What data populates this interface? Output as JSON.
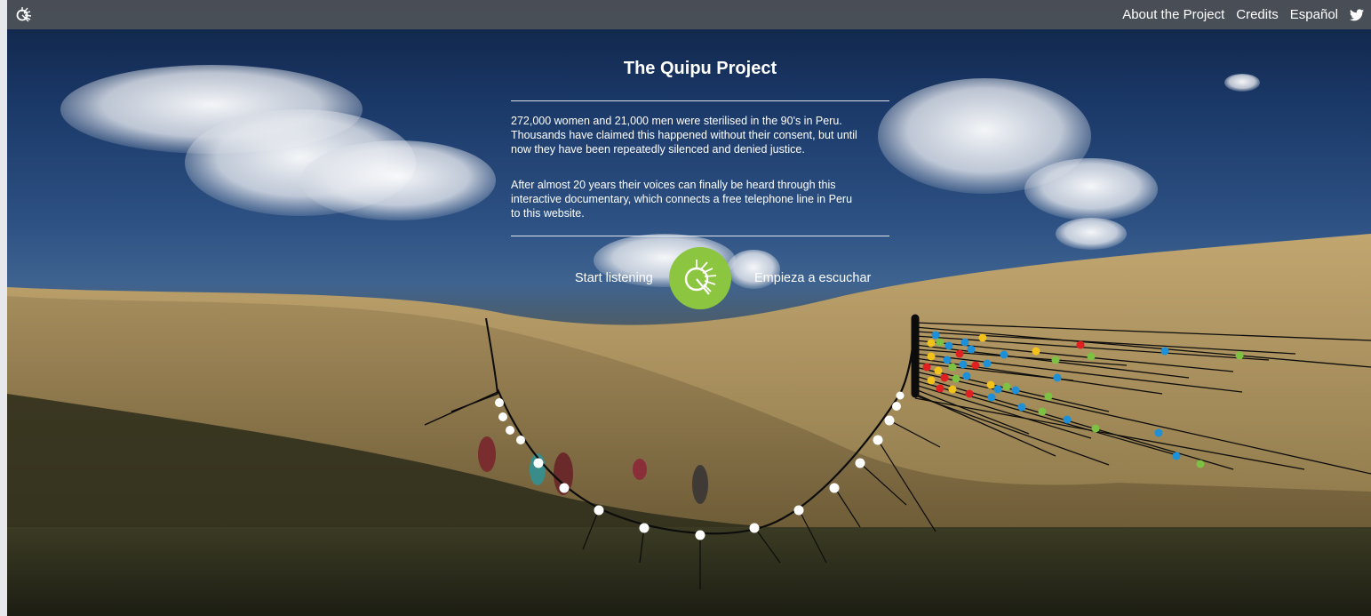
{
  "header": {
    "logo_icon": "quipu-logo-icon",
    "nav": [
      "About the Project",
      "Credits",
      "Español"
    ],
    "twitter_icon": "twitter-icon"
  },
  "intro": {
    "title": "The Quipu Project",
    "paragraph1_lines": [
      "272,000 women and 21,000 men were sterilised in the 90's in Peru.",
      "Thousands have claimed this happened without their consent, but until",
      "now they have been repeatedly silenced and denied justice."
    ],
    "paragraph2_lines": [
      "After almost 20 years their voices can finally be heard through this",
      "interactive documentary, which connects a free telephone line in Peru",
      "to this website."
    ]
  },
  "cta": {
    "start_en": "Start listening",
    "start_es": "Empieza a escuchar",
    "button_icon": "quipu-logo-icon"
  },
  "colors": {
    "accent_green": "#8cc540",
    "topbar": "#4e5258",
    "knot_blue": "#1e90d8",
    "knot_red": "#e02020",
    "knot_yellow": "#f2c21b",
    "knot_green": "#7cc142"
  }
}
